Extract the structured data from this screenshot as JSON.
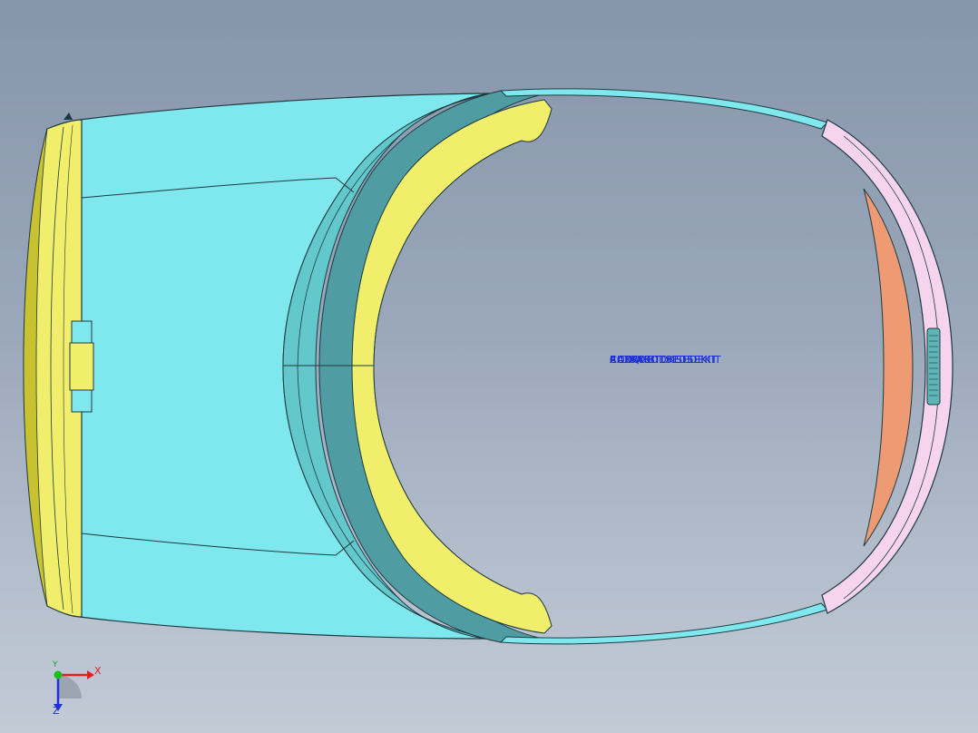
{
  "viewport": {
    "background_top": "#8795ab",
    "background_bottom": "#c2cad6"
  },
  "colors": {
    "cyan_body": "#7fe8ee",
    "cyan_shadow": "#5fb4b8",
    "yellow_part": "#f0ee6a",
    "yellow_dark": "#c9c230",
    "pink_band": "#f6d4ee",
    "orange_pad": "#ee9a72",
    "annotation_blue": "#1a2cd8"
  },
  "annotation": {
    "layers": [
      "ACXRDIODKETEEKIT",
      "CIDOASITDKSEDEKIT",
      "CADQXBITSEDSEKIT",
      "ROOWKIT"
    ]
  },
  "triad": {
    "x_label": "X",
    "y_label": "Y",
    "z_label": "Z"
  }
}
